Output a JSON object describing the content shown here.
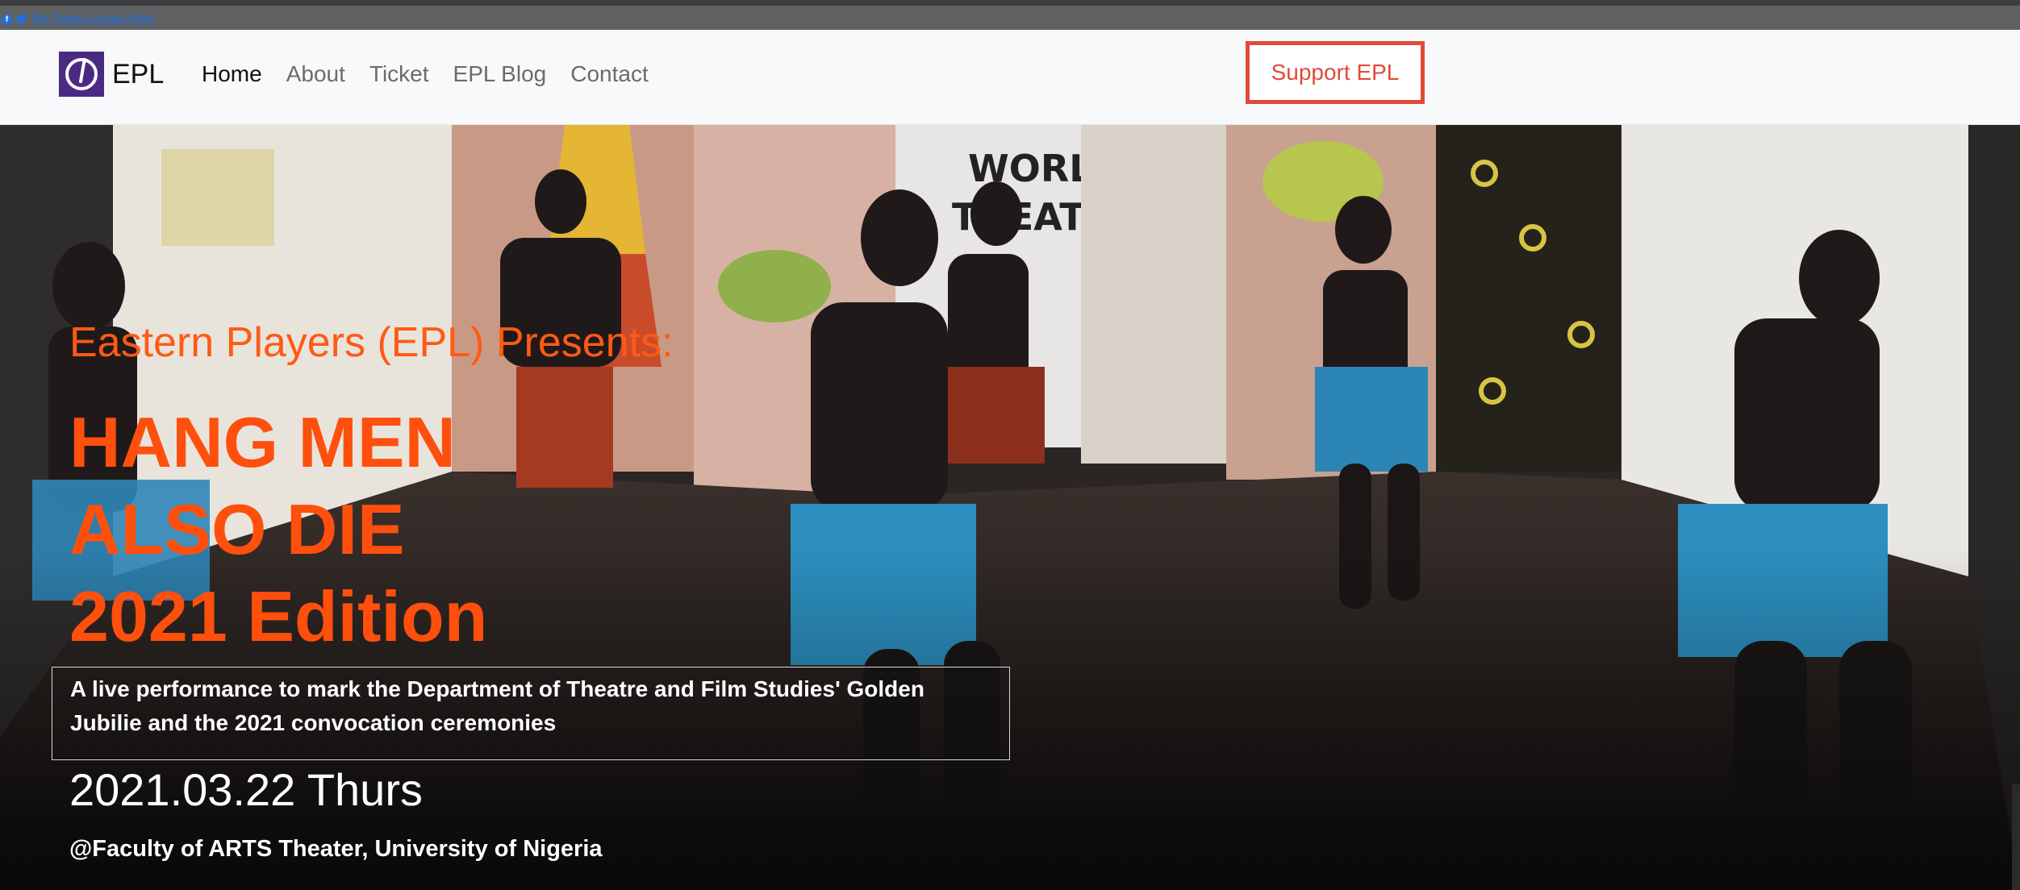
{
  "topbar": {
    "links_text": "My Page Logout Inbo",
    "icons": [
      "facebook-icon",
      "twitter-icon"
    ]
  },
  "navbar": {
    "brand": "EPL",
    "links": [
      {
        "label": "Home",
        "active": true
      },
      {
        "label": "About",
        "active": false
      },
      {
        "label": "Ticket",
        "active": false
      },
      {
        "label": "EPL Blog",
        "active": false
      },
      {
        "label": "Contact",
        "active": false
      }
    ],
    "support_button": "Support EPL"
  },
  "hero": {
    "presents": "Eastern Players (EPL) Presents:",
    "title_lines": [
      "HANG MEN",
      "ALSO DIE",
      "2021 Edition"
    ],
    "description": "A live performance to mark the Department of Theatre and Film Studies' Golden Jubilie and the 2021 convocation ceremonies",
    "date": "2021.03.22 Thurs",
    "venue": "@Faculty of ARTS Theater, University of Nigeria"
  },
  "colors": {
    "accent_orange": "#ff4f0d",
    "support_red": "#e04a3a",
    "brand_purple": "#4b2a84",
    "link_blue": "#1f6fe0"
  }
}
